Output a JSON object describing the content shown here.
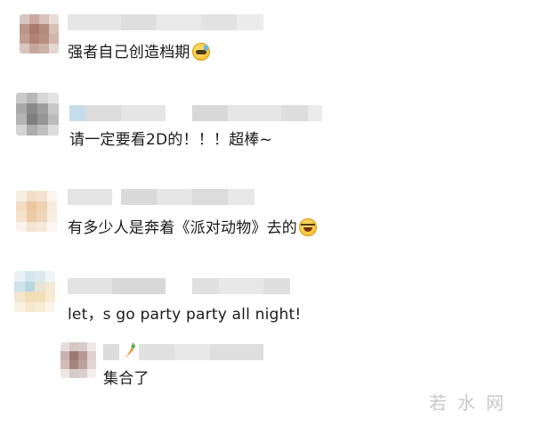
{
  "comments": [
    {
      "text": "强者自己创造档期",
      "emoji": "sweat-smile-emoji"
    },
    {
      "text": "请一定要看2D的！！！超棒~"
    },
    {
      "text": "有多少人是奔着《派对动物》去的",
      "emoji": "laughing-emoji"
    },
    {
      "text": "let，s  go  party party all night!",
      "reply": {
        "text": "集合了",
        "name_icon": "carrot-icon"
      }
    }
  ],
  "watermark": "若水网"
}
